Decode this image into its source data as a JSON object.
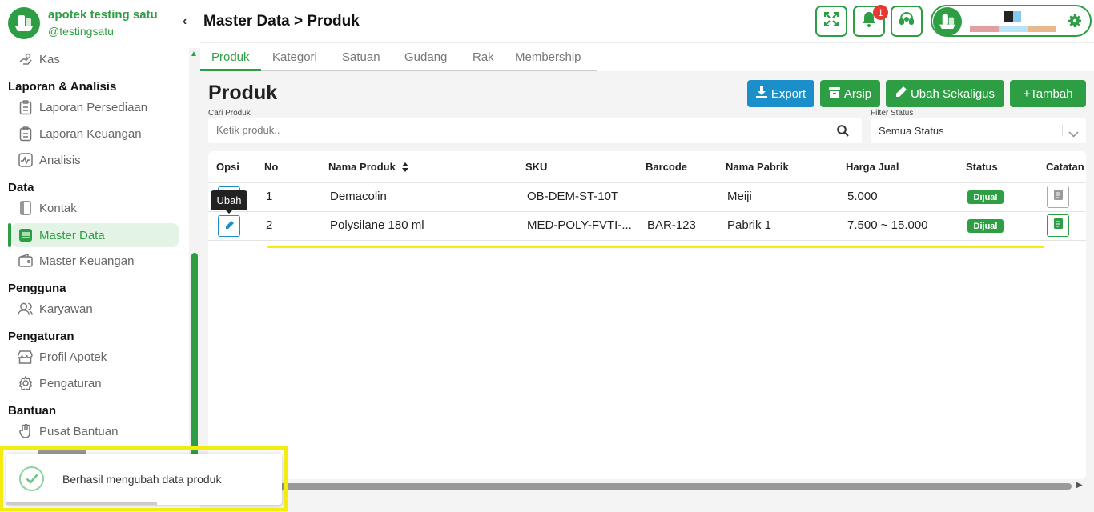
{
  "sidebar": {
    "brand_name": "apotek testing satu",
    "brand_handle": "@testingsatu",
    "items": [
      {
        "label": "Kas"
      },
      {
        "section": "Laporan & Analisis"
      },
      {
        "label": "Laporan Persediaan"
      },
      {
        "label": "Laporan Keuangan"
      },
      {
        "label": "Analisis"
      },
      {
        "section": "Data"
      },
      {
        "label": "Kontak"
      },
      {
        "label": "Master Data",
        "active": true
      },
      {
        "label": "Master Keuangan"
      },
      {
        "section": "Pengguna"
      },
      {
        "label": "Karyawan"
      },
      {
        "section": "Pengaturan"
      },
      {
        "label": "Profil Apotek"
      },
      {
        "label": "Pengaturan"
      },
      {
        "section": "Bantuan"
      },
      {
        "label": "Pusat Bantuan"
      }
    ]
  },
  "header": {
    "title": "Master Data > Produk",
    "notification_count": "1",
    "icons": [
      "fullscreen-icon",
      "bell-icon",
      "headset-icon",
      "gear-icon"
    ]
  },
  "tabs": [
    {
      "label": "Produk",
      "active": true
    },
    {
      "label": "Kategori"
    },
    {
      "label": "Satuan"
    },
    {
      "label": "Gudang"
    },
    {
      "label": "Rak"
    },
    {
      "label": "Membership"
    }
  ],
  "main": {
    "section_title": "Produk",
    "actions": {
      "export": "Export",
      "archive": "Arsip",
      "bulk_edit": "Ubah Sekaligus",
      "add": "+Tambah"
    },
    "search": {
      "label": "Cari Produk",
      "placeholder": "Ketik produk.."
    },
    "filter": {
      "label": "Filter Status",
      "value": "Semua Status"
    }
  },
  "table": {
    "columns": [
      "Opsi",
      "No",
      "Nama Produk",
      "SKU",
      "Barcode",
      "Nama Pabrik",
      "Harga Jual",
      "Status",
      "Catatan"
    ],
    "rows": [
      {
        "no": "1",
        "name": "Demacolin",
        "sku": "OB-DEM-ST-10T",
        "barcode": "",
        "factory": "Meiji",
        "price": "5.000",
        "status": "Dijual"
      },
      {
        "no": "2",
        "name": "Polysilane 180 ml",
        "sku": "MED-POLY-FVTI-...",
        "barcode": "BAR-123",
        "factory": "Pabrik 1",
        "price": "7.500 ~ 15.000",
        "status": "Dijual"
      }
    ],
    "tooltip": "Ubah"
  },
  "toast": {
    "message": "Berhasil mengubah data produk",
    "type": "success"
  },
  "colors": {
    "primary": "#2e9e44",
    "export": "#1a8fc9",
    "highlight": "#f4ec10",
    "badge": "#e53935"
  }
}
